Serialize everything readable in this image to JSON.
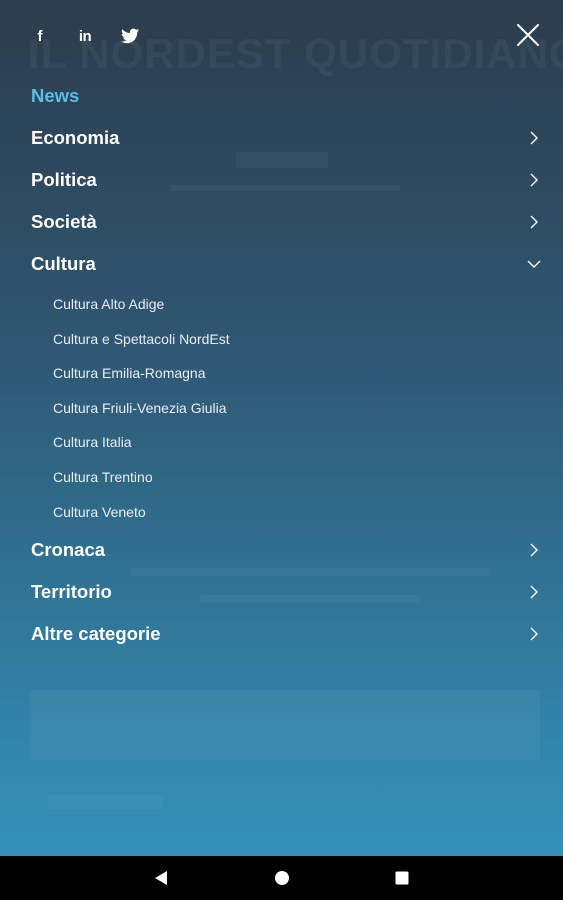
{
  "social": {
    "facebook_glyph": "f",
    "linkedin_glyph": "in",
    "icons": [
      "facebook-icon",
      "linkedin-icon",
      "twitter-icon",
      "close-icon"
    ]
  },
  "background_masthead": "IL NORDEST QUOTIDIANO",
  "menu": {
    "active_item": "News",
    "items": [
      {
        "label": "News",
        "active": true,
        "chevron": "none"
      },
      {
        "label": "Economia",
        "chevron": "right"
      },
      {
        "label": "Politica",
        "chevron": "right"
      },
      {
        "label": "Società",
        "chevron": "right"
      },
      {
        "label": "Cultura",
        "chevron": "down",
        "expanded": true
      },
      {
        "label": "Cronaca",
        "chevron": "right"
      },
      {
        "label": "Territorio",
        "chevron": "right"
      },
      {
        "label": "Altre categorie",
        "chevron": "right"
      }
    ],
    "cultura_subitems": [
      "Cultura Alto Adige",
      "Cultura e Spettacoli NordEst",
      "Cultura Emilia-Romagna",
      "Cultura Friuli-Venezia Giulia",
      "Cultura Italia",
      "Cultura Trentino",
      "Cultura Veneto"
    ]
  },
  "colors": {
    "active": "#5cbde6",
    "text": "#ffffff",
    "gradient_top": "#2c3c4c",
    "gradient_bottom": "#3590b8",
    "navbar": "#000000"
  },
  "navbar": {
    "buttons": [
      "back-icon",
      "home-icon",
      "recents-icon"
    ]
  }
}
